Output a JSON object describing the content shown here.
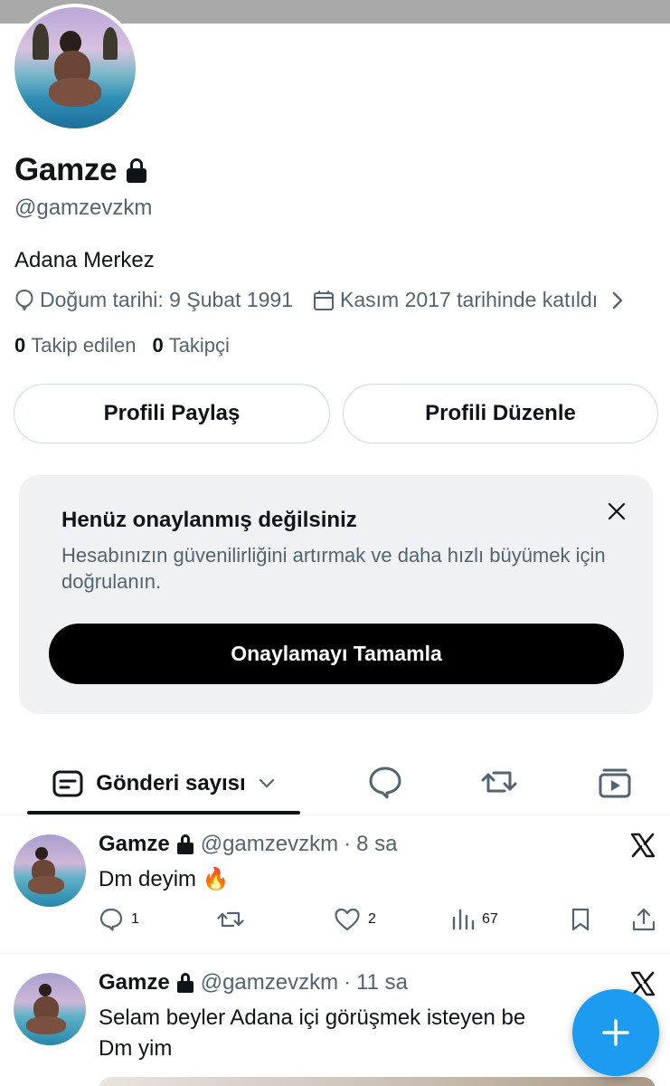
{
  "profile": {
    "name": "Gamze",
    "handle": "@gamzevzkm",
    "bio": "Adana Merkez",
    "birthday": "Doğum tarihi: 9 Şubat 1991",
    "joined": "Kasım 2017 tarihinde katıldı",
    "following_count": "0",
    "following_label": "Takip edilen",
    "followers_count": "0",
    "followers_label": "Takipçi"
  },
  "buttons": {
    "share_profile": "Profili Paylaş",
    "edit_profile": "Profili Düzenle"
  },
  "verify_card": {
    "title": "Henüz onaylanmış değilsiniz",
    "description": "Hesabınızın güvenilirliğini artırmak ve daha hızlı büyümek için doğrulanın.",
    "button": "Onaylamayı Tamamla"
  },
  "tabs": {
    "active_label": "Gönderi sayısı",
    "icons": [
      "replies-icon",
      "reposts-icon",
      "media-icon"
    ]
  },
  "tweets": [
    {
      "name": "Gamze",
      "handle": "@gamzevzkm",
      "time": "8 sa",
      "text": "Dm deyim 🔥",
      "replies": "1",
      "reposts": "",
      "likes": "2",
      "views": "67"
    },
    {
      "name": "Gamze",
      "handle": "@gamzevzkm",
      "time": "11 sa",
      "text_line1": "Selam beyler Adana içi görüşmek isteyen be",
      "text_line2": "Dm yim"
    }
  ],
  "separator": "·",
  "colors": {
    "primary_text": "#0f1419",
    "secondary_text": "#536471",
    "accent": "#1d9bf0",
    "card_bg": "#eff1f3"
  }
}
